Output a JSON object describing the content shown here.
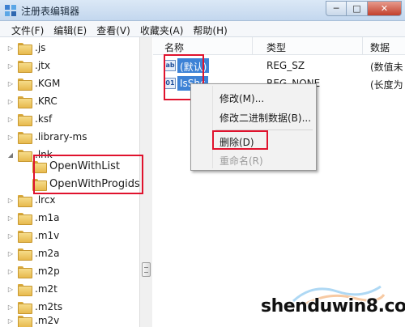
{
  "window": {
    "title": "注册表编辑器",
    "minimize_label": "─",
    "maximize_label": "□",
    "close_label": "✕"
  },
  "menu": [
    "文件(F)",
    "编辑(E)",
    "查看(V)",
    "收藏夹(A)",
    "帮助(H)"
  ],
  "tree": {
    "items": [
      {
        "label": ".js",
        "arrow": "▷"
      },
      {
        "label": ".jtx",
        "arrow": "▷"
      },
      {
        "label": ".KGM",
        "arrow": "▷"
      },
      {
        "label": ".KRC",
        "arrow": "▷"
      },
      {
        "label": ".ksf",
        "arrow": "▷"
      },
      {
        "label": ".library-ms",
        "arrow": "▷"
      },
      {
        "label": ".lnk",
        "arrow": "◢"
      },
      {
        "label": "OpenWithList",
        "arrow": ""
      },
      {
        "label": "OpenWithProgids",
        "arrow": ""
      },
      {
        "label": ".lrcx",
        "arrow": "▷"
      },
      {
        "label": ".m1a",
        "arrow": "▷"
      },
      {
        "label": ".m1v",
        "arrow": "▷"
      },
      {
        "label": ".m2a",
        "arrow": "▷"
      },
      {
        "label": ".m2p",
        "arrow": "▷"
      },
      {
        "label": ".m2t",
        "arrow": "▷"
      },
      {
        "label": ".m2ts",
        "arrow": "▷"
      },
      {
        "label": ".m2v",
        "arrow": "▷"
      }
    ]
  },
  "list": {
    "columns": [
      "名称",
      "类型",
      "数据"
    ],
    "rows": [
      {
        "name": "(默认)",
        "type": "REG_SZ",
        "data": "(数值未",
        "icon": "ab"
      },
      {
        "name": "IsShc",
        "type": "REG_NONE",
        "data": "(长度为",
        "icon": "01"
      }
    ]
  },
  "context_menu": {
    "items": [
      {
        "label": "修改(M)...",
        "enabled": true
      },
      {
        "label": "修改二进制数据(B)...",
        "enabled": true
      },
      {
        "label": "删除(D)",
        "enabled": true
      },
      {
        "label": "重命名(R)",
        "enabled": false
      }
    ]
  },
  "watermark": {
    "text": "shenduwin8.com"
  },
  "colors": {
    "highlight_box": "#e0122d",
    "selection": "#3d82d6"
  }
}
